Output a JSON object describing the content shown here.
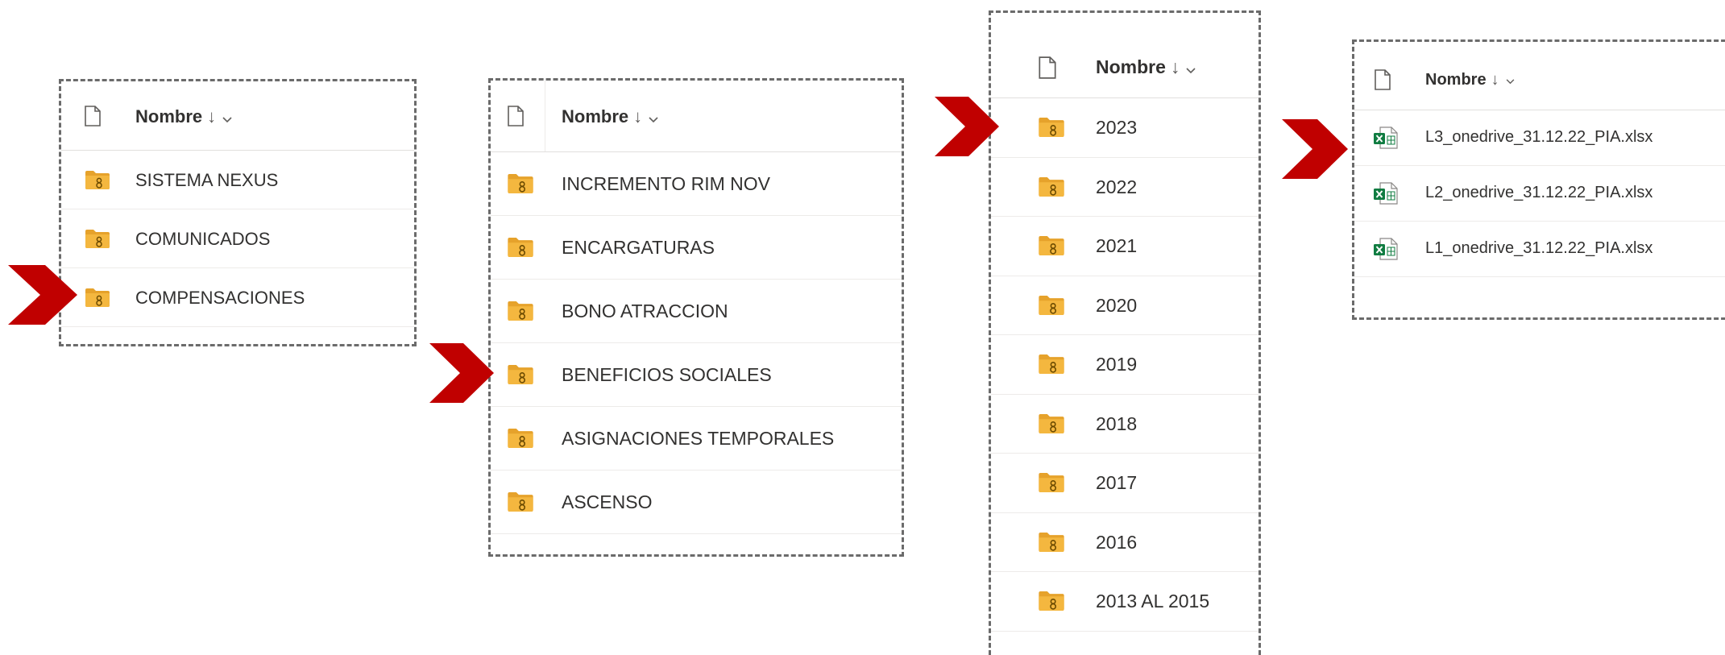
{
  "panels": [
    {
      "header": {
        "sort_label": "Nombre",
        "sort_arrow": "↓"
      },
      "items": [
        {
          "name": "SISTEMA NEXUS",
          "icon": "shared-folder-icon"
        },
        {
          "name": "COMUNICADOS",
          "icon": "shared-folder-icon"
        },
        {
          "name": "COMPENSACIONES",
          "icon": "shared-folder-icon"
        }
      ]
    },
    {
      "header": {
        "sort_label": "Nombre",
        "sort_arrow": "↓"
      },
      "items": [
        {
          "name": "INCREMENTO RIM NOV",
          "icon": "shared-folder-icon"
        },
        {
          "name": "ENCARGATURAS",
          "icon": "shared-folder-icon"
        },
        {
          "name": "BONO ATRACCION",
          "icon": "shared-folder-icon"
        },
        {
          "name": "BENEFICIOS SOCIALES",
          "icon": "shared-folder-icon"
        },
        {
          "name": "ASIGNACIONES TEMPORALES",
          "icon": "shared-folder-icon"
        },
        {
          "name": "ASCENSO",
          "icon": "shared-folder-icon"
        }
      ]
    },
    {
      "header": {
        "sort_label": "Nombre",
        "sort_arrow": "↓"
      },
      "items": [
        {
          "name": "2023",
          "icon": "shared-folder-icon"
        },
        {
          "name": "2022",
          "icon": "shared-folder-icon"
        },
        {
          "name": "2021",
          "icon": "shared-folder-icon"
        },
        {
          "name": "2020",
          "icon": "shared-folder-icon"
        },
        {
          "name": "2019",
          "icon": "shared-folder-icon"
        },
        {
          "name": "2018",
          "icon": "shared-folder-icon"
        },
        {
          "name": "2017",
          "icon": "shared-folder-icon"
        },
        {
          "name": "2016",
          "icon": "shared-folder-icon"
        },
        {
          "name": "2013 AL 2015",
          "icon": "shared-folder-icon"
        }
      ]
    },
    {
      "header": {
        "sort_label": "Nombre",
        "sort_arrow": "↓"
      },
      "items": [
        {
          "name": "L3_onedrive_31.12.22_PIA.xlsx",
          "icon": "excel-file-icon"
        },
        {
          "name": "L2_onedrive_31.12.22_PIA.xlsx",
          "icon": "excel-file-icon"
        },
        {
          "name": "L1_onedrive_31.12.22_PIA.xlsx",
          "icon": "excel-file-icon"
        }
      ]
    }
  ],
  "colors": {
    "pointer": "#c00000",
    "folder": "#f4b73f",
    "folder_back": "#e6a22b",
    "excel": "#107c41",
    "dashed_border": "#6b6b6b"
  }
}
